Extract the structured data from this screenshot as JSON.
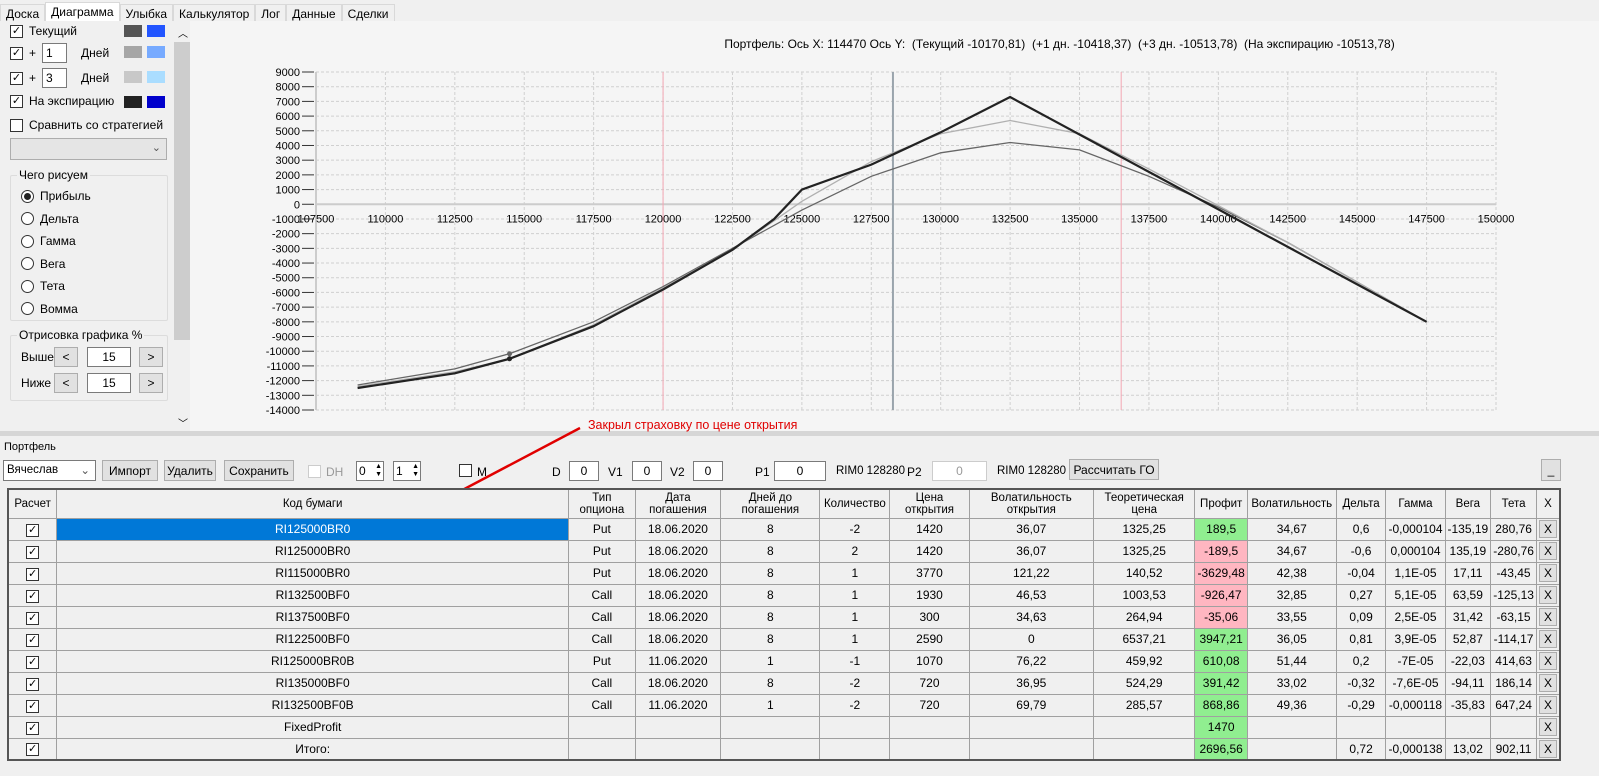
{
  "tabs": [
    "Доска",
    "Диаграмма",
    "Улыбка",
    "Калькулятор",
    "Лог",
    "Данные",
    "Сделки"
  ],
  "active_tab": "Диаграмма",
  "settings": {
    "current_label": "Текущий",
    "plus_label": "+",
    "days_label": "Дней",
    "plus1_value": "1",
    "plus3_value": "3",
    "expiration_label": "На экспирацию",
    "compare_label": "Сравнить со стратегией",
    "colors": {
      "current": [
        "#555555",
        "#2255ff"
      ],
      "plus1": [
        "#a6a6a6",
        "#77aaff"
      ],
      "plus3": [
        "#c8c8c8",
        "#aaddff"
      ],
      "expiration": [
        "#222222",
        "#0000cc"
      ]
    },
    "draw_group_title": "Чего рисуем",
    "draw_options": [
      "Прибыль",
      "Дельта",
      "Гамма",
      "Вега",
      "Тета",
      "Вомма"
    ],
    "draw_selected": "Прибыль",
    "range_group_title": "Отрисовка графика %",
    "above_label": "Выше",
    "above_value": "15",
    "below_label": "Ниже",
    "below_value": "15",
    "dec": "<",
    "inc": ">"
  },
  "chart_data": {
    "type": "line",
    "title": "Портфель: Ось X: 114470 Ось Y:  (Текущий -10170,81)  (+1 дн. -10418,37)  (+3 дн. -10513,78)  (На экспирацию -10513,78)",
    "xlim": [
      107500,
      150000
    ],
    "ylim": [
      -14000,
      9000
    ],
    "x_ticks": [
      107500,
      110000,
      112500,
      115000,
      117500,
      120000,
      122500,
      125000,
      127500,
      130000,
      132500,
      135000,
      137500,
      140000,
      142500,
      145000,
      147500,
      150000
    ],
    "y_ticks": [
      9000,
      8000,
      7000,
      6000,
      5000,
      4000,
      3000,
      2000,
      1000,
      0,
      -1000,
      -2000,
      -3000,
      -4000,
      -5000,
      -6000,
      -7000,
      -8000,
      -9000,
      -10000,
      -11000,
      -12000,
      -13000,
      -14000
    ],
    "grid": true,
    "cursor_x": 114470,
    "current_price_line": 128280,
    "range_lines": [
      120000,
      136500
    ],
    "series": [
      {
        "key": "current",
        "color": "#666666",
        "points": [
          [
            109000,
            -12300
          ],
          [
            112500,
            -11200
          ],
          [
            114470,
            -10171
          ],
          [
            117500,
            -8000
          ],
          [
            120000,
            -5600
          ],
          [
            122500,
            -3000
          ],
          [
            125000,
            -400
          ],
          [
            127500,
            1900
          ],
          [
            130000,
            3500
          ],
          [
            132500,
            4200
          ],
          [
            135000,
            3700
          ],
          [
            137500,
            1900
          ],
          [
            140000,
            -200
          ],
          [
            142500,
            -2600
          ],
          [
            145000,
            -5300
          ],
          [
            147500,
            -8000
          ]
        ]
      },
      {
        "key": "plus3",
        "color": "#b0b0b0",
        "points": [
          [
            109000,
            -12400
          ],
          [
            112500,
            -11400
          ],
          [
            114470,
            -10514
          ],
          [
            117500,
            -8200
          ],
          [
            120000,
            -5700
          ],
          [
            122500,
            -3100
          ],
          [
            125000,
            200
          ],
          [
            127500,
            2900
          ],
          [
            130000,
            4800
          ],
          [
            132500,
            5700
          ],
          [
            135000,
            4800
          ],
          [
            137500,
            2400
          ],
          [
            140000,
            -100
          ],
          [
            142500,
            -2600
          ],
          [
            145000,
            -5300
          ],
          [
            147500,
            -8000
          ]
        ]
      },
      {
        "key": "expiration",
        "color": "#222222",
        "points": [
          [
            109000,
            -12500
          ],
          [
            112500,
            -11500
          ],
          [
            114470,
            -10514
          ],
          [
            117500,
            -8300
          ],
          [
            120000,
            -5800
          ],
          [
            122500,
            -3100
          ],
          [
            124000,
            -1000
          ],
          [
            125000,
            1000
          ],
          [
            127500,
            2700
          ],
          [
            130000,
            4900
          ],
          [
            132500,
            7300
          ],
          [
            135000,
            4750
          ],
          [
            137500,
            2200
          ],
          [
            140000,
            -350
          ],
          [
            142500,
            -2900
          ],
          [
            145000,
            -5450
          ],
          [
            147500,
            -8000
          ]
        ]
      }
    ]
  },
  "annotation": "Закрыл страховку по цене открытия",
  "portfolio": {
    "group_title": "Портфель",
    "account": "Вячеслав",
    "import": "Импорт",
    "delete": "Удалить",
    "save": "Сохранить",
    "dh_label": "DH",
    "dh_a": "0",
    "dh_b": "1",
    "m_label": "M",
    "d_label": "D",
    "d_value": "0",
    "v1_label": "V1",
    "v1_value": "0",
    "v2_label": "V2",
    "v2_value": "0",
    "p1_label": "P1",
    "p1_value": "0",
    "p1_ref": "RIM0 128280",
    "p2_label": "P2",
    "p2_value": "0",
    "p2_ref": "RIM0 128280",
    "calc_go": "Рассчитать ГО",
    "minimize": "_"
  },
  "table": {
    "headers": [
      "Расчет",
      "Код бумаги",
      "Тип опциона",
      "Дата погашения",
      "Дней до погашения",
      "Количество",
      "Цена открытия",
      "Волатильность открытия",
      "Теоретическая цена",
      "Профит",
      "Волатильность",
      "Дельта",
      "Гамма",
      "Вега",
      "Тета",
      "X"
    ],
    "rows": [
      [
        "RI125000BR0",
        "Put",
        "18.06.2020",
        "8",
        "-2",
        "1420",
        "36,07",
        "1325,25",
        "189,5",
        "34,67",
        "0,6",
        "-0,000104",
        "-135,19",
        "280,76"
      ],
      [
        "RI125000BR0",
        "Put",
        "18.06.2020",
        "8",
        "2",
        "1420",
        "36,07",
        "1325,25",
        "-189,5",
        "34,67",
        "-0,6",
        "0,000104",
        "135,19",
        "-280,76"
      ],
      [
        "RI115000BR0",
        "Put",
        "18.06.2020",
        "8",
        "1",
        "3770",
        "121,22",
        "140,52",
        "-3629,48",
        "42,38",
        "-0,04",
        "1,1E-05",
        "17,11",
        "-43,45"
      ],
      [
        "RI132500BF0",
        "Call",
        "18.06.2020",
        "8",
        "1",
        "1930",
        "46,53",
        "1003,53",
        "-926,47",
        "32,85",
        "0,27",
        "5,1E-05",
        "63,59",
        "-125,13"
      ],
      [
        "RI137500BF0",
        "Call",
        "18.06.2020",
        "8",
        "1",
        "300",
        "34,63",
        "264,94",
        "-35,06",
        "33,55",
        "0,09",
        "2,5E-05",
        "31,42",
        "-63,15"
      ],
      [
        "RI122500BF0",
        "Call",
        "18.06.2020",
        "8",
        "1",
        "2590",
        "0",
        "6537,21",
        "3947,21",
        "36,05",
        "0,81",
        "3,9E-05",
        "52,87",
        "-114,17"
      ],
      [
        "RI125000BR0B",
        "Put",
        "11.06.2020",
        "1",
        "-1",
        "1070",
        "76,22",
        "459,92",
        "610,08",
        "51,44",
        "0,2",
        "-7E-05",
        "-22,03",
        "414,63"
      ],
      [
        "RI135000BF0",
        "Call",
        "18.06.2020",
        "8",
        "-2",
        "720",
        "36,95",
        "524,29",
        "391,42",
        "33,02",
        "-0,32",
        "-7,6E-05",
        "-94,11",
        "186,14"
      ],
      [
        "RI132500BF0B",
        "Call",
        "11.06.2020",
        "1",
        "-2",
        "720",
        "69,79",
        "285,57",
        "868,86",
        "49,36",
        "-0,29",
        "-0,000118",
        "-35,83",
        "647,24"
      ],
      [
        "FixedProfit",
        "",
        "",
        "",
        "",
        "",
        "",
        "",
        "1470",
        "",
        "",
        "",
        "",
        ""
      ],
      [
        "Итого:",
        "",
        "",
        "",
        "",
        "",
        "",
        "",
        "2696,56",
        "",
        "0,72",
        "-0,000138",
        "13,02",
        "902,11"
      ]
    ],
    "delete_label": "X",
    "check": "✓"
  }
}
